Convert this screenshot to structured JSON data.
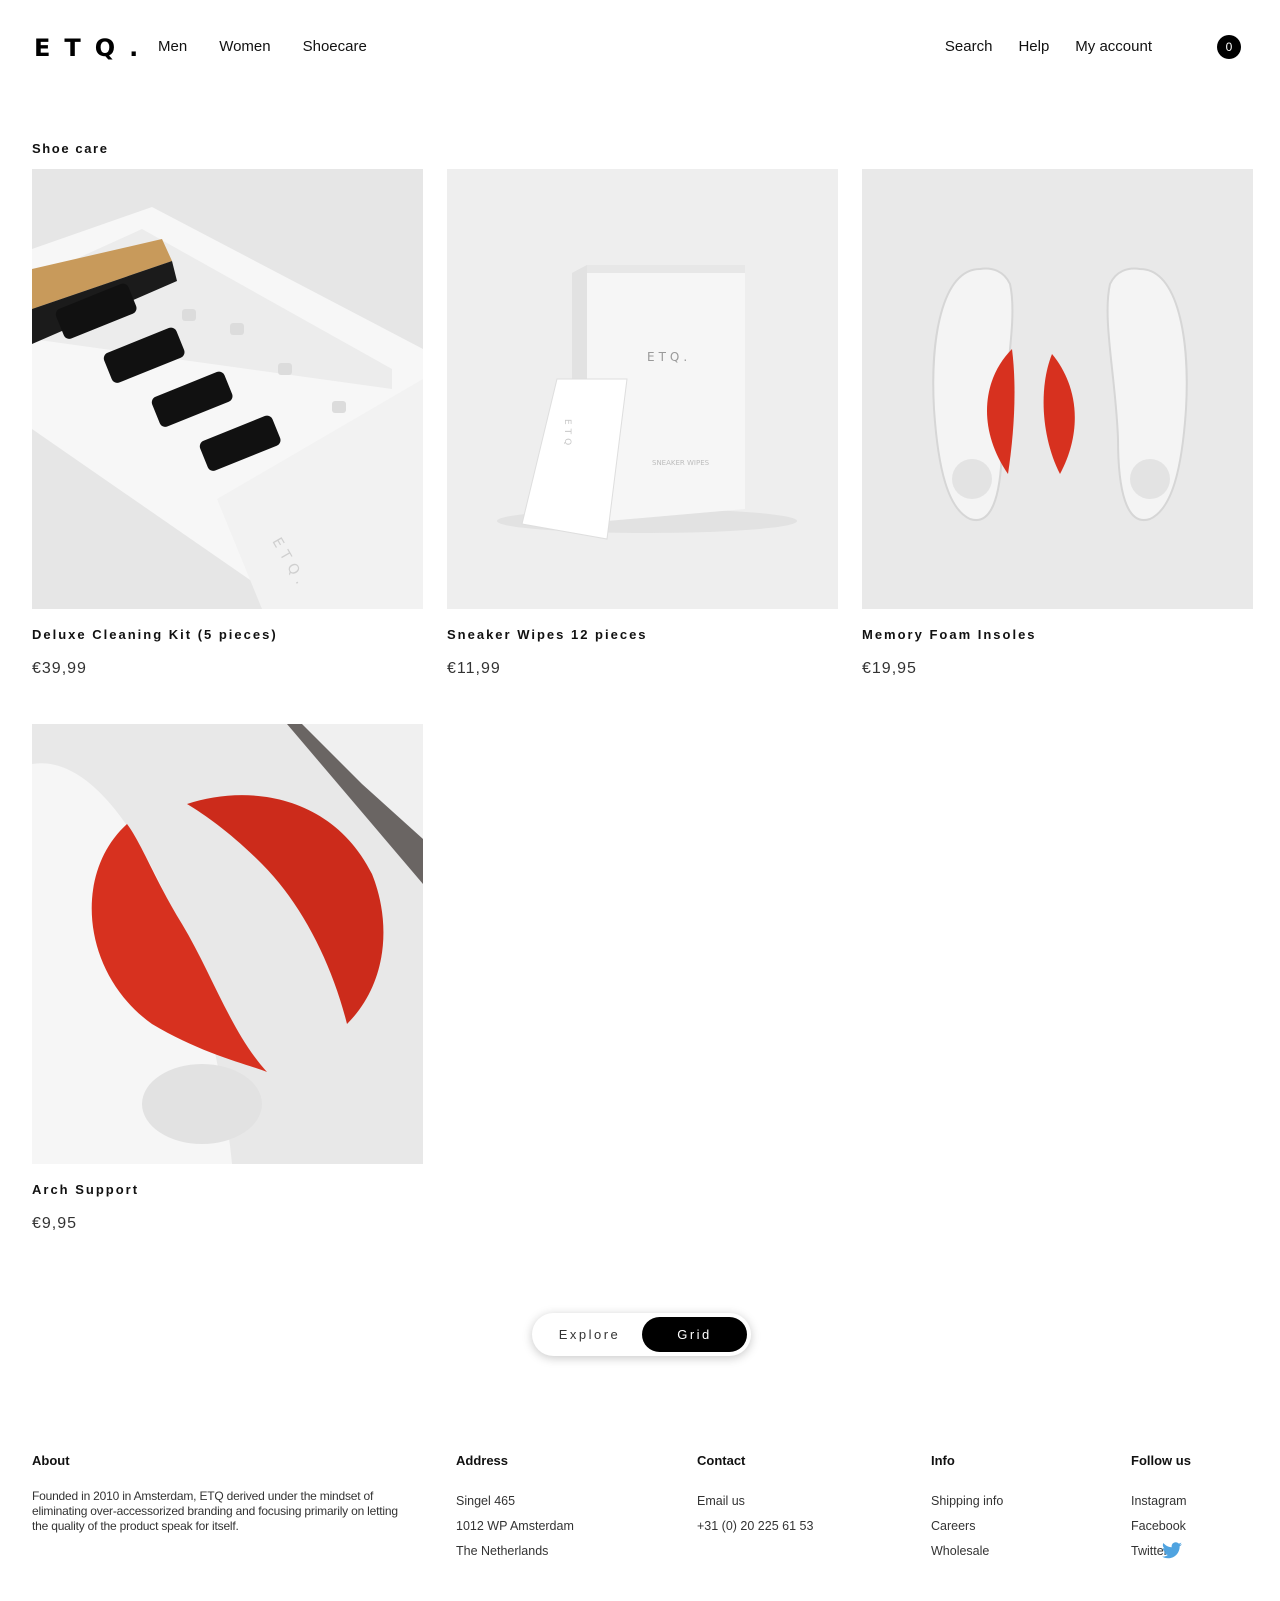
{
  "header": {
    "logo": "ETQ.",
    "nav_left": [
      "Men",
      "Women",
      "Shoecare"
    ],
    "nav_right": [
      "Search",
      "Help",
      "My account"
    ],
    "cart_count": "0"
  },
  "section": {
    "title": "Shoe care"
  },
  "products": [
    {
      "name": "Deluxe Cleaning Kit (5 pieces)",
      "price": "€39,99"
    },
    {
      "name": "Sneaker Wipes 12 pieces",
      "price": "€11,99"
    },
    {
      "name": "Memory Foam Insoles",
      "price": "€19,95"
    },
    {
      "name": "Arch Support",
      "price": "€9,95"
    }
  ],
  "view_toggle": {
    "explore": "Explore",
    "grid": "Grid",
    "active": "Grid"
  },
  "footer": {
    "about": {
      "heading": "About",
      "text": "Founded in 2010 in Amsterdam, ETQ derived under the mindset of eliminating over-accessorized branding and focusing primarily on letting the quality of the product speak for itself."
    },
    "address": {
      "heading": "Address",
      "lines": [
        "Singel 465",
        "1012 WP Amsterdam",
        "The Netherlands"
      ]
    },
    "contact": {
      "heading": "Contact",
      "lines": [
        "Email us",
        "+31 (0) 20 225 61 53"
      ]
    },
    "info": {
      "heading": "Info",
      "links": [
        "Shipping info",
        "Careers",
        "Wholesale"
      ]
    },
    "follow": {
      "heading": "Follow us",
      "links": [
        "Instagram",
        "Facebook",
        "Twitter"
      ]
    }
  },
  "colors": {
    "accent_red": "#d7311f",
    "twitter_blue": "#4fa3e0",
    "black": "#000000"
  },
  "icons": {
    "twitter": "twitter-bird-icon"
  }
}
